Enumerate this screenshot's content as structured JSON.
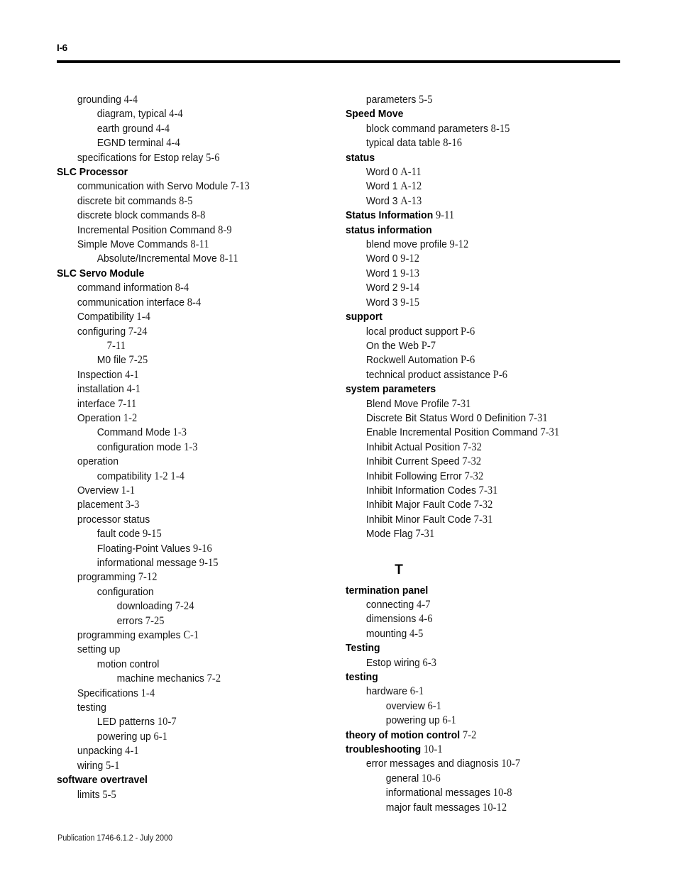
{
  "header": {
    "folio": "I-6"
  },
  "footer": {
    "publication": "Publication 1746-6.1.2 - July 2000"
  },
  "left_column": {
    "entries": [
      {
        "text": "grounding",
        "pages": [
          "4-4"
        ],
        "level": 1,
        "bold": false
      },
      {
        "text": "diagram, typical",
        "pages": [
          "4-4"
        ],
        "level": 2,
        "bold": false
      },
      {
        "text": "earth ground",
        "pages": [
          "4-4"
        ],
        "level": 2,
        "bold": false
      },
      {
        "text": "EGND terminal",
        "pages": [
          "4-4"
        ],
        "level": 2,
        "bold": false
      },
      {
        "text": "specifications for Estop relay",
        "pages": [
          "5-6"
        ],
        "level": 1,
        "bold": false
      },
      {
        "text": "SLC Processor",
        "pages": [],
        "level": 0,
        "bold": true
      },
      {
        "text": "communication with Servo Module",
        "pages": [
          "7-13"
        ],
        "level": 1,
        "bold": false
      },
      {
        "text": "discrete bit commands",
        "pages": [
          "8-5"
        ],
        "level": 1,
        "bold": false
      },
      {
        "text": "discrete block commands",
        "pages": [
          "8-8"
        ],
        "level": 1,
        "bold": false
      },
      {
        "text": "Incremental Position Command",
        "pages": [
          "8-9"
        ],
        "level": 1,
        "bold": false
      },
      {
        "text": "Simple Move Commands",
        "pages": [
          "8-11"
        ],
        "level": 1,
        "bold": false
      },
      {
        "text": "Absolute/Incremental Move",
        "pages": [
          "8-11"
        ],
        "level": 2,
        "bold": false
      },
      {
        "text": "SLC Servo Module",
        "pages": [],
        "level": 0,
        "bold": true
      },
      {
        "text": "command information",
        "pages": [
          "8-4"
        ],
        "level": 1,
        "bold": false
      },
      {
        "text": "communication interface",
        "pages": [
          "8-4"
        ],
        "level": 1,
        "bold": false
      },
      {
        "text": "Compatibility",
        "pages": [
          "1-4"
        ],
        "level": 1,
        "bold": false
      },
      {
        "text": "configuring",
        "pages": [
          "7-24"
        ],
        "level": 1,
        "bold": false
      },
      {
        "text": "",
        "pages": [
          "7-11"
        ],
        "level": "2b",
        "bold": false
      },
      {
        "text": "M0 file",
        "pages": [
          "7-25"
        ],
        "level": 2,
        "bold": false
      },
      {
        "text": "Inspection",
        "pages": [
          "4-1"
        ],
        "level": 1,
        "bold": false
      },
      {
        "text": "installation",
        "pages": [
          "4-1"
        ],
        "level": 1,
        "bold": false
      },
      {
        "text": "interface",
        "pages": [
          "7-11"
        ],
        "level": 1,
        "bold": false
      },
      {
        "text": "Operation",
        "pages": [
          "1-2"
        ],
        "level": 1,
        "bold": false
      },
      {
        "text": "Command Mode",
        "pages": [
          "1-3"
        ],
        "level": 2,
        "bold": false
      },
      {
        "text": "configuration mode",
        "pages": [
          "1-3"
        ],
        "level": 2,
        "bold": false
      },
      {
        "text": "operation",
        "pages": [],
        "level": 1,
        "bold": false
      },
      {
        "text": "compatibility",
        "pages": [
          "1-2",
          "1-4"
        ],
        "level": 2,
        "bold": false
      },
      {
        "text": "Overview",
        "pages": [
          "1-1"
        ],
        "level": 1,
        "bold": false
      },
      {
        "text": "placement",
        "pages": [
          "3-3"
        ],
        "level": 1,
        "bold": false
      },
      {
        "text": "processor status",
        "pages": [],
        "level": 1,
        "bold": false
      },
      {
        "text": "fault code",
        "pages": [
          "9-15"
        ],
        "level": 2,
        "bold": false
      },
      {
        "text": "Floating-Point Values",
        "pages": [
          "9-16"
        ],
        "level": 2,
        "bold": false
      },
      {
        "text": "informational message",
        "pages": [
          "9-15"
        ],
        "level": 2,
        "bold": false
      },
      {
        "text": "programming",
        "pages": [
          "7-12"
        ],
        "level": 1,
        "bold": false
      },
      {
        "text": "configuration",
        "pages": [],
        "level": 2,
        "bold": false
      },
      {
        "text": "downloading",
        "pages": [
          "7-24"
        ],
        "level": 3,
        "bold": false
      },
      {
        "text": "errors",
        "pages": [
          "7-25"
        ],
        "level": 3,
        "bold": false
      },
      {
        "text": "programming examples",
        "pages": [
          "C-1"
        ],
        "level": 1,
        "bold": false
      },
      {
        "text": "setting up",
        "pages": [],
        "level": 1,
        "bold": false
      },
      {
        "text": "motion control",
        "pages": [],
        "level": 2,
        "bold": false
      },
      {
        "text": "machine mechanics",
        "pages": [
          "7-2"
        ],
        "level": 3,
        "bold": false
      },
      {
        "text": "Specifications",
        "pages": [
          "1-4"
        ],
        "level": 1,
        "bold": false
      },
      {
        "text": "testing",
        "pages": [],
        "level": 1,
        "bold": false
      },
      {
        "text": "LED patterns",
        "pages": [
          "10-7"
        ],
        "level": 2,
        "bold": false
      },
      {
        "text": "powering up",
        "pages": [
          "6-1"
        ],
        "level": 2,
        "bold": false
      },
      {
        "text": "unpacking",
        "pages": [
          "4-1"
        ],
        "level": 1,
        "bold": false
      },
      {
        "text": "wiring",
        "pages": [
          "5-1"
        ],
        "level": 1,
        "bold": false
      },
      {
        "text": "software overtravel",
        "pages": [],
        "level": 0,
        "bold": true
      },
      {
        "text": "limits",
        "pages": [
          "5-5"
        ],
        "level": 1,
        "bold": false
      }
    ]
  },
  "right_column": {
    "entries_before_letter": [
      {
        "text": "parameters",
        "pages": [
          "5-5"
        ],
        "level": 1,
        "bold": false
      },
      {
        "text": "Speed Move",
        "pages": [],
        "level": 0,
        "bold": true
      },
      {
        "text": "block command parameters",
        "pages": [
          "8-15"
        ],
        "level": 1,
        "bold": false
      },
      {
        "text": "typical data table",
        "pages": [
          "8-16"
        ],
        "level": 1,
        "bold": false
      },
      {
        "text": "status",
        "pages": [],
        "level": 0,
        "bold": true
      },
      {
        "text": "Word 0",
        "pages": [
          "A-11"
        ],
        "level": 1,
        "bold": false
      },
      {
        "text": "Word 1",
        "pages": [
          "A-12"
        ],
        "level": 1,
        "bold": false
      },
      {
        "text": "Word 3",
        "pages": [
          "A-13"
        ],
        "level": 1,
        "bold": false
      },
      {
        "text": "Status Information",
        "pages": [
          "9-11"
        ],
        "level": 0,
        "bold": true
      },
      {
        "text": "status information",
        "pages": [],
        "level": 0,
        "bold": true
      },
      {
        "text": "blend move profile",
        "pages": [
          "9-12"
        ],
        "level": 1,
        "bold": false
      },
      {
        "text": "Word 0",
        "pages": [
          "9-12"
        ],
        "level": 1,
        "bold": false
      },
      {
        "text": "Word 1",
        "pages": [
          "9-13"
        ],
        "level": 1,
        "bold": false
      },
      {
        "text": "Word 2",
        "pages": [
          "9-14"
        ],
        "level": 1,
        "bold": false
      },
      {
        "text": "Word 3",
        "pages": [
          "9-15"
        ],
        "level": 1,
        "bold": false
      },
      {
        "text": "support",
        "pages": [],
        "level": 0,
        "bold": true
      },
      {
        "text": "local product support",
        "pages": [
          "P-6"
        ],
        "level": 1,
        "bold": false
      },
      {
        "text": "On the Web",
        "pages": [
          "P-7"
        ],
        "level": 1,
        "bold": false
      },
      {
        "text": "Rockwell Automation",
        "pages": [
          "P-6"
        ],
        "level": 1,
        "bold": false
      },
      {
        "text": "technical product assistance",
        "pages": [
          "P-6"
        ],
        "level": 1,
        "bold": false
      },
      {
        "text": "system parameters",
        "pages": [],
        "level": 0,
        "bold": true
      },
      {
        "text": "Blend Move Profile",
        "pages": [
          "7-31"
        ],
        "level": 1,
        "bold": false
      },
      {
        "text": "Discrete Bit Status Word 0 Definition",
        "pages": [
          "7-31"
        ],
        "level": 1,
        "bold": false
      },
      {
        "text": "Enable Incremental Position Command",
        "pages": [
          "7-31"
        ],
        "level": 1,
        "bold": false
      },
      {
        "text": "Inhibit Actual Position",
        "pages": [
          "7-32"
        ],
        "level": 1,
        "bold": false
      },
      {
        "text": "Inhibit Current Speed",
        "pages": [
          "7-32"
        ],
        "level": 1,
        "bold": false
      },
      {
        "text": "Inhibit Following Error",
        "pages": [
          "7-32"
        ],
        "level": 1,
        "bold": false
      },
      {
        "text": "Inhibit Information Codes",
        "pages": [
          "7-31"
        ],
        "level": 1,
        "bold": false
      },
      {
        "text": "Inhibit Major Fault Code",
        "pages": [
          "7-32"
        ],
        "level": 1,
        "bold": false
      },
      {
        "text": "Inhibit Minor Fault Code",
        "pages": [
          "7-31"
        ],
        "level": 1,
        "bold": false
      },
      {
        "text": "Mode Flag",
        "pages": [
          "7-31"
        ],
        "level": 1,
        "bold": false
      }
    ],
    "letter_heading": "T",
    "entries_after_letter": [
      {
        "text": "termination panel",
        "pages": [],
        "level": 0,
        "bold": true
      },
      {
        "text": "connecting",
        "pages": [
          "4-7"
        ],
        "level": 1,
        "bold": false
      },
      {
        "text": "dimensions",
        "pages": [
          "4-6"
        ],
        "level": 1,
        "bold": false
      },
      {
        "text": "mounting",
        "pages": [
          "4-5"
        ],
        "level": 1,
        "bold": false
      },
      {
        "text": "Testing",
        "pages": [],
        "level": 0,
        "bold": true
      },
      {
        "text": "Estop wiring",
        "pages": [
          "6-3"
        ],
        "level": 1,
        "bold": false
      },
      {
        "text": "testing",
        "pages": [],
        "level": 0,
        "bold": true
      },
      {
        "text": "hardware",
        "pages": [
          "6-1"
        ],
        "level": 1,
        "bold": false
      },
      {
        "text": "overview",
        "pages": [
          "6-1"
        ],
        "level": 2,
        "bold": false
      },
      {
        "text": "powering up",
        "pages": [
          "6-1"
        ],
        "level": 2,
        "bold": false
      },
      {
        "text": "theory of motion control",
        "pages": [
          "7-2"
        ],
        "level": 0,
        "bold": true
      },
      {
        "text": "troubleshooting",
        "pages": [
          "10-1"
        ],
        "level": 0,
        "bold": true
      },
      {
        "text": "error messages and diagnosis",
        "pages": [
          "10-7"
        ],
        "level": 1,
        "bold": false
      },
      {
        "text": "general",
        "pages": [
          "10-6"
        ],
        "level": 2,
        "bold": false
      },
      {
        "text": "informational messages",
        "pages": [
          "10-8"
        ],
        "level": 2,
        "bold": false
      },
      {
        "text": "major fault messages",
        "pages": [
          "10-12"
        ],
        "level": 2,
        "bold": false
      }
    ]
  }
}
